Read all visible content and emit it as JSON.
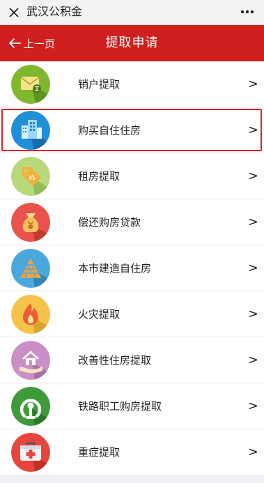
{
  "window": {
    "title": "武汉公积金"
  },
  "nav": {
    "back_label": "上一页",
    "title": "提取申请"
  },
  "colors": {
    "nav_background": "#cf1f1f",
    "highlight_border": "#d9222a"
  },
  "items": [
    {
      "label": "销户提取",
      "icon": "envelope-icon",
      "chevron": ">"
    },
    {
      "label": "购买自住住房",
      "icon": "building-icon",
      "chevron": ">",
      "highlighted": true
    },
    {
      "label": "租房提取",
      "icon": "price-tag-icon",
      "chevron": ">"
    },
    {
      "label": "偿还购房贷款",
      "icon": "money-bag-icon",
      "chevron": ">"
    },
    {
      "label": "本市建造自住房",
      "icon": "brick-house-icon",
      "chevron": ">"
    },
    {
      "label": "火灾提取",
      "icon": "fire-icon",
      "chevron": ">"
    },
    {
      "label": "改善性住房提取",
      "icon": "house-in-hand-icon",
      "chevron": ">"
    },
    {
      "label": "铁路职工购房提取",
      "icon": "railway-logo-icon",
      "chevron": ">"
    },
    {
      "label": "重症提取",
      "icon": "medical-kit-icon",
      "chevron": ">"
    }
  ]
}
